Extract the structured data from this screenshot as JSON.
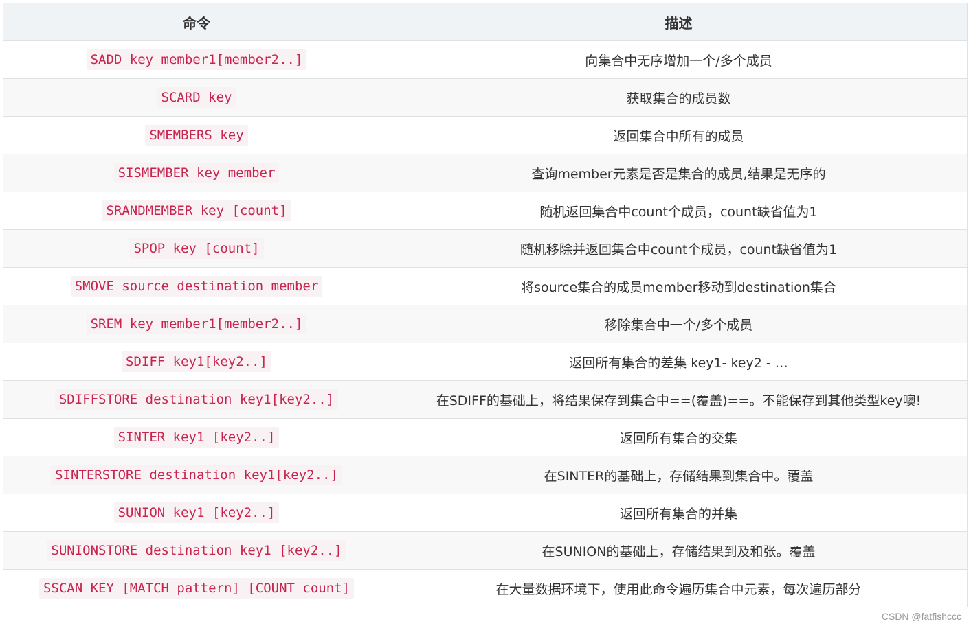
{
  "table": {
    "headers": [
      "命令",
      "描述"
    ],
    "rows": [
      {
        "command": "SADD key member1[member2..]",
        "description": "向集合中无序增加一个/多个成员"
      },
      {
        "command": "SCARD key",
        "description": "获取集合的成员数"
      },
      {
        "command": "SMEMBERS key",
        "description": "返回集合中所有的成员"
      },
      {
        "command": "SISMEMBER key member",
        "description": "查询member元素是否是集合的成员,结果是无序的"
      },
      {
        "command": "SRANDMEMBER key [count]",
        "description": "随机返回集合中count个成员，count缺省值为1"
      },
      {
        "command": "SPOP key [count]",
        "description": "随机移除并返回集合中count个成员，count缺省值为1"
      },
      {
        "command": "SMOVE source destination member",
        "description": "将source集合的成员member移动到destination集合"
      },
      {
        "command": "SREM key member1[member2..]",
        "description": "移除集合中一个/多个成员"
      },
      {
        "command": "SDIFF key1[key2..]",
        "description": "返回所有集合的差集 key1- key2 - …"
      },
      {
        "command": "SDIFFSTORE destination key1[key2..]",
        "description": "在SDIFF的基础上，将结果保存到集合中==(覆盖)==。不能保存到其他类型key噢!"
      },
      {
        "command": "SINTER key1 [key2..]",
        "description": "返回所有集合的交集"
      },
      {
        "command": "SINTERSTORE destination key1[key2..]",
        "description": "在SINTER的基础上，存储结果到集合中。覆盖"
      },
      {
        "command": "SUNION key1 [key2..]",
        "description": "返回所有集合的并集"
      },
      {
        "command": "SUNIONSTORE destination key1 [key2..]",
        "description": "在SUNION的基础上，存储结果到及和张。覆盖"
      },
      {
        "command": "SSCAN KEY [MATCH pattern] [COUNT count]",
        "description": "在大量数据环境下，使用此命令遍历集合中元素，每次遍历部分"
      }
    ]
  },
  "watermark": "CSDN @fatfishccc",
  "colors": {
    "header_bg": "#eff3f5",
    "stripe_bg": "#f8f8f8",
    "border": "#dfe2e5",
    "code_text": "#c7254e",
    "code_bg": "#f9f2f4"
  }
}
